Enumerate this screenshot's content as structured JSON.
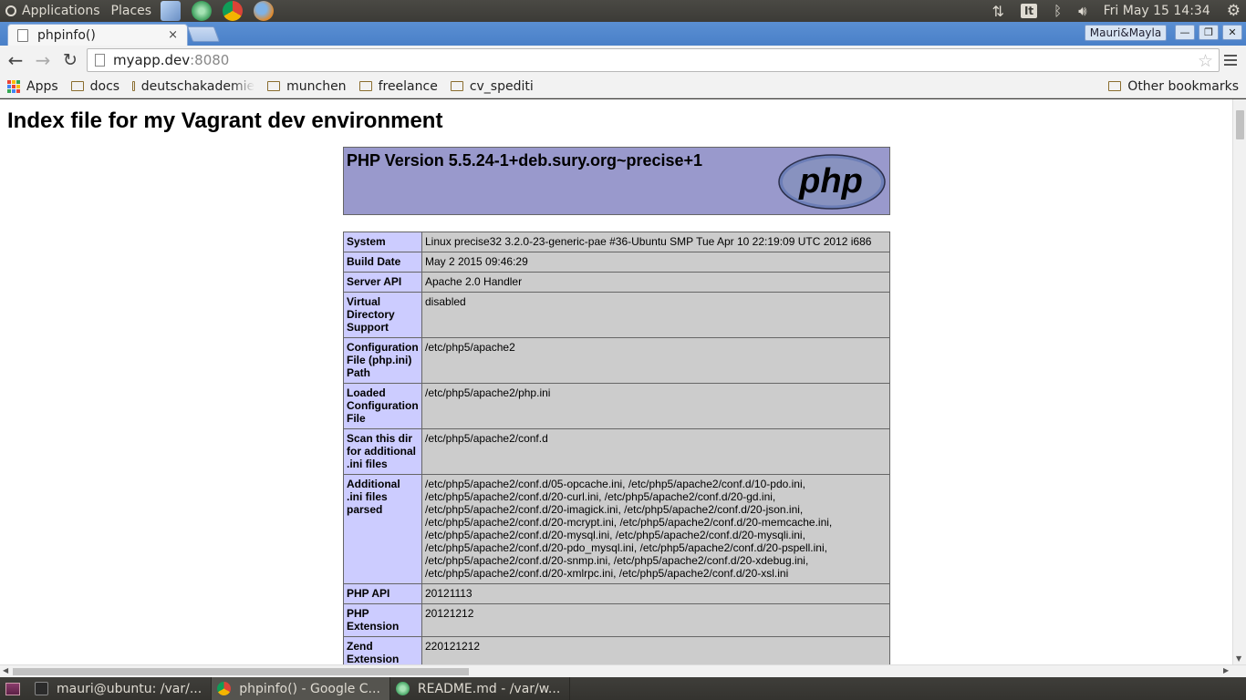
{
  "system_panel": {
    "applications": "Applications",
    "places": "Places",
    "keyboard_layout": "It",
    "clock": "Fri May 15 14:34"
  },
  "browser": {
    "tab_title": "phpinfo()",
    "tab_close": "×",
    "profile_name": "Mauri&Mayla",
    "url_host": "myapp.dev",
    "url_port": ":8080",
    "bookmarks": [
      {
        "label": "Apps"
      },
      {
        "label": "docs"
      },
      {
        "label": "deutschakademie"
      },
      {
        "label": "munchen"
      },
      {
        "label": "freelance"
      },
      {
        "label": "cv_spediti"
      }
    ],
    "other_bookmarks": "Other bookmarks"
  },
  "page": {
    "heading": "Index file for my Vagrant dev environment",
    "php_version_title": "PHP Version 5.5.24-1+deb.sury.org~precise+1",
    "logo_text": "php",
    "rows": [
      {
        "key": "System",
        "value": "Linux precise32 3.2.0-23-generic-pae #36-Ubuntu SMP Tue Apr 10 22:19:09 UTC 2012 i686"
      },
      {
        "key": "Build Date",
        "value": "May 2 2015 09:46:29"
      },
      {
        "key": "Server API",
        "value": "Apache 2.0 Handler"
      },
      {
        "key": "Virtual Directory Support",
        "value": "disabled"
      },
      {
        "key": "Configuration File (php.ini) Path",
        "value": "/etc/php5/apache2"
      },
      {
        "key": "Loaded Configuration File",
        "value": "/etc/php5/apache2/php.ini"
      },
      {
        "key": "Scan this dir for additional .ini files",
        "value": "/etc/php5/apache2/conf.d"
      },
      {
        "key": "Additional .ini files parsed",
        "value": "/etc/php5/apache2/conf.d/05-opcache.ini, /etc/php5/apache2/conf.d/10-pdo.ini, /etc/php5/apache2/conf.d/20-curl.ini, /etc/php5/apache2/conf.d/20-gd.ini, /etc/php5/apache2/conf.d/20-imagick.ini, /etc/php5/apache2/conf.d/20-json.ini, /etc/php5/apache2/conf.d/20-mcrypt.ini, /etc/php5/apache2/conf.d/20-memcache.ini, /etc/php5/apache2/conf.d/20-mysql.ini, /etc/php5/apache2/conf.d/20-mysqli.ini, /etc/php5/apache2/conf.d/20-pdo_mysql.ini, /etc/php5/apache2/conf.d/20-pspell.ini, /etc/php5/apache2/conf.d/20-snmp.ini, /etc/php5/apache2/conf.d/20-xdebug.ini, /etc/php5/apache2/conf.d/20-xmlrpc.ini, /etc/php5/apache2/conf.d/20-xsl.ini"
      },
      {
        "key": "PHP API",
        "value": "20121113"
      },
      {
        "key": "PHP Extension",
        "value": "20121212"
      },
      {
        "key": "Zend Extension",
        "value": "220121212"
      },
      {
        "key": "",
        "value": ""
      }
    ]
  },
  "taskbar": {
    "items": [
      {
        "label": "mauri@ubuntu: /var/..."
      },
      {
        "label": "phpinfo() - Google C..."
      },
      {
        "label": "README.md - /var/w..."
      }
    ]
  },
  "colors": {
    "php_header_bg": "#9999cc",
    "key_cell_bg": "#ccccff",
    "value_cell_bg": "#cccccc",
    "tabstrip_blue": "#4a80c8"
  }
}
